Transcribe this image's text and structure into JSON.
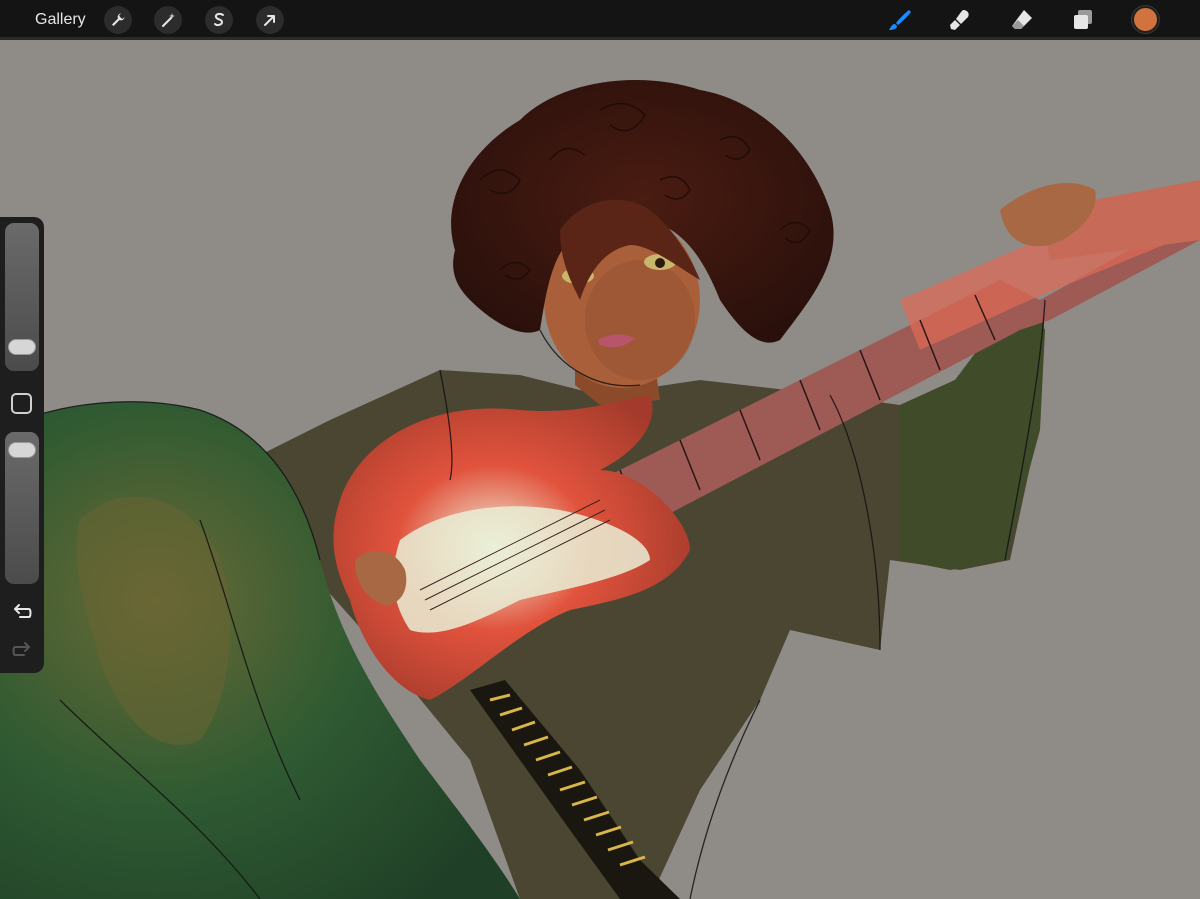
{
  "toolbar": {
    "gallery_label": "Gallery",
    "left_tools": [
      "wrench-icon",
      "magic-wand-icon",
      "selection-icon",
      "transform-arrow-icon"
    ],
    "right_tools": [
      "brush-icon",
      "smudge-icon",
      "eraser-icon",
      "layers-icon"
    ],
    "active_tool": "brush-icon",
    "accent_color": "#1e8cff",
    "current_color": "#d2733f"
  },
  "sidebar": {
    "brush_size_level": 0.1,
    "opacity_level": 0.95,
    "tools": [
      "modify-square-icon",
      "undo-icon",
      "redo-icon"
    ]
  },
  "canvas": {
    "background_color": "#8f8b87"
  }
}
